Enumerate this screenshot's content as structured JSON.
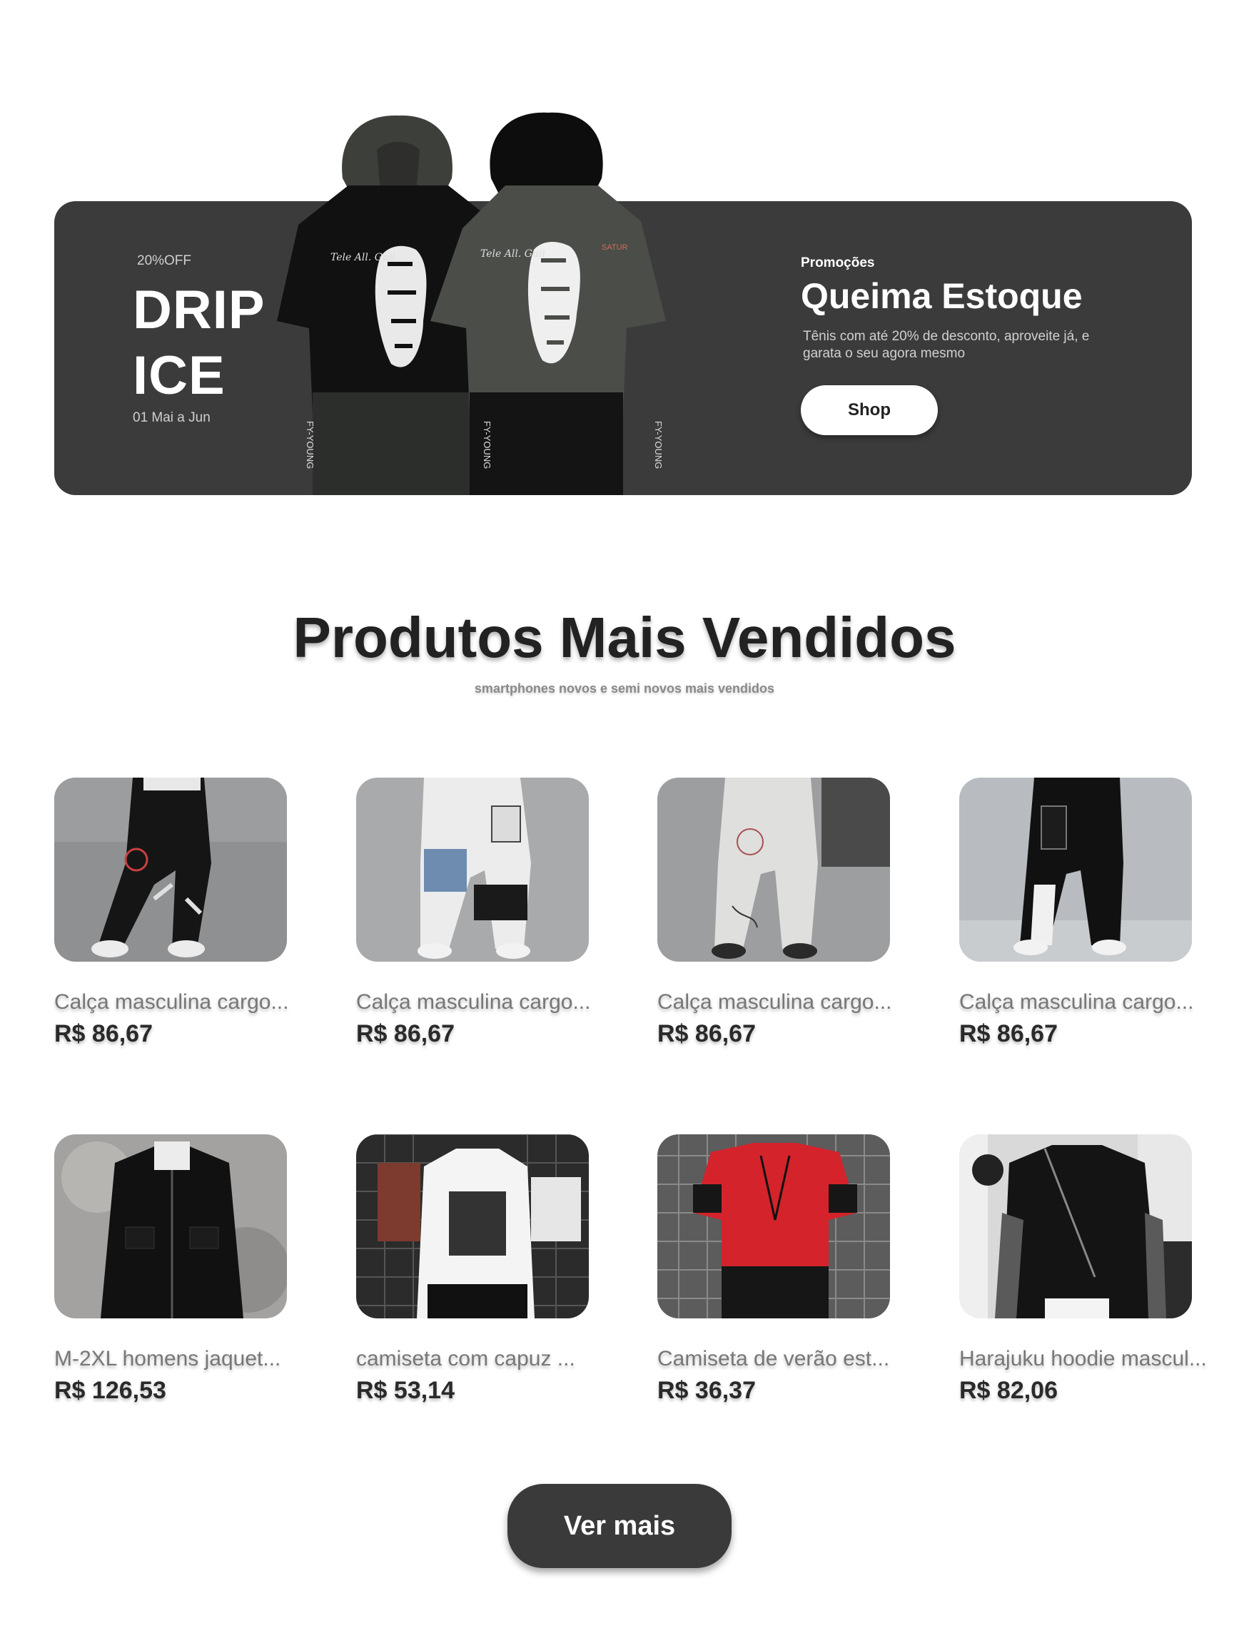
{
  "banner": {
    "discount": "20%OFF",
    "brand_line1": "DRIP",
    "brand_line2": "ICE",
    "dates": "01 Mai a Jun",
    "promo_tag": "Promoções",
    "promo_title": "Queima Estoque",
    "promo_desc": "Tênis com até 20% de desconto, aproveite já, e garata o seu agora mesmo",
    "shop_label": "Shop",
    "hoodie_text": "FY-YOUNG"
  },
  "section": {
    "title": "Produtos Mais Vendidos",
    "subtitle": "smartphones novos e semi novos mais vendidos"
  },
  "products": [
    {
      "name": "Calça masculina cargo...",
      "price": "R$ 86,67"
    },
    {
      "name": "Calça masculina cargo...",
      "price": "R$ 86,67"
    },
    {
      "name": "Calça masculina cargo...",
      "price": "R$ 86,67"
    },
    {
      "name": "Calça masculina cargo...",
      "price": "R$ 86,67"
    },
    {
      "name": "M-2XL homens jaquet...",
      "price": "R$ 126,53"
    },
    {
      "name": "camiseta com capuz ...",
      "price": "R$ 53,14"
    },
    {
      "name": "Camiseta de verão est...",
      "price": "R$ 36,37"
    },
    {
      "name": "Harajuku hoodie mascul...",
      "price": "R$ 82,06"
    }
  ],
  "more_label": "Ver mais",
  "colors": {
    "banner_bg": "#3b3b3b",
    "button_dark": "#3a3a3a",
    "price": "#2a2a2a",
    "name": "#777777"
  }
}
